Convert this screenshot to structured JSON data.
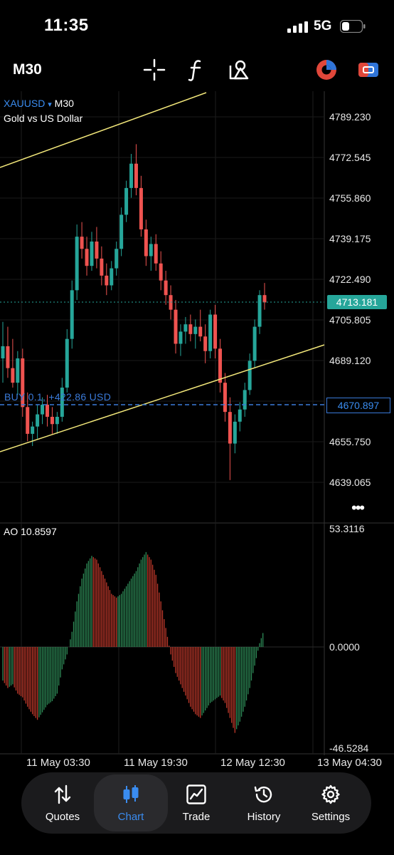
{
  "status": {
    "time": "11:35",
    "network": "5G"
  },
  "toolbar": {
    "timeframe": "M30",
    "icons": [
      "crosshair-icon",
      "function-icon",
      "objects-icon",
      "one-click-trading-icon",
      "account-icon"
    ]
  },
  "chart": {
    "symbol": "XAUUSD",
    "dropdown": "▾",
    "timeframe": "M30",
    "description": "Gold vs US Dollar",
    "current_price": "4713.181",
    "order_price": "4670.897",
    "order_label": "BUY 0.1, +422.86 USD",
    "price_labels": [
      "4789.230",
      "4772.545",
      "4755.860",
      "4739.175",
      "4722.490",
      "4705.805",
      "4689.120",
      "4655.750",
      "4639.065"
    ],
    "time_labels": [
      "11 May 03:30",
      "11 May 19:30",
      "12 May 12:30",
      "13 May 04:30"
    ],
    "more": "•••",
    "colors": {
      "bull": "#26a69a",
      "bear": "#ef5350",
      "trendline": "#f2e77a",
      "order": "#3a7ad9",
      "bid_line": "#26a69a"
    }
  },
  "indicator": {
    "label": "AO 10.8597",
    "max": "53.3116",
    "zero": "0.0000",
    "min": "-46.5284"
  },
  "chart_data": {
    "type": "candlestick",
    "symbol": "XAUUSD",
    "timeframe": "M30",
    "ylim": [
      4630,
      4800
    ],
    "candles": [
      [
        4690,
        4705,
        4680,
        4695
      ],
      [
        4695,
        4703,
        4682,
        4686
      ],
      [
        4686,
        4698,
        4678,
        4680
      ],
      [
        4680,
        4693,
        4675,
        4690
      ],
      [
        4690,
        4694,
        4666,
        4670
      ],
      [
        4670,
        4676,
        4656,
        4659
      ],
      [
        4659,
        4664,
        4654,
        4662
      ],
      [
        4662,
        4671,
        4657,
        4667
      ],
      [
        4667,
        4674,
        4663,
        4671
      ],
      [
        4671,
        4675,
        4662,
        4666
      ],
      [
        4666,
        4670,
        4659,
        4663
      ],
      [
        4663,
        4668,
        4659,
        4666
      ],
      [
        4666,
        4682,
        4664,
        4678
      ],
      [
        4678,
        4702,
        4676,
        4698
      ],
      [
        4698,
        4722,
        4694,
        4718
      ],
      [
        4718,
        4745,
        4714,
        4740
      ],
      [
        4740,
        4746,
        4731,
        4735
      ],
      [
        4735,
        4740,
        4724,
        4728
      ],
      [
        4728,
        4742,
        4726,
        4738
      ],
      [
        4738,
        4744,
        4727,
        4731
      ],
      [
        4731,
        4736,
        4720,
        4724
      ],
      [
        4724,
        4729,
        4716,
        4720
      ],
      [
        4720,
        4730,
        4718,
        4727
      ],
      [
        4727,
        4738,
        4724,
        4735
      ],
      [
        4735,
        4752,
        4732,
        4749
      ],
      [
        4749,
        4763,
        4746,
        4760
      ],
      [
        4760,
        4774,
        4756,
        4770
      ],
      [
        4770,
        4778,
        4757,
        4760
      ],
      [
        4760,
        4765,
        4740,
        4743
      ],
      [
        4743,
        4747,
        4728,
        4732
      ],
      [
        4732,
        4740,
        4726,
        4737
      ],
      [
        4737,
        4741,
        4726,
        4729
      ],
      [
        4729,
        4734,
        4718,
        4722
      ],
      [
        4722,
        4726,
        4712,
        4716
      ],
      [
        4716,
        4720,
        4706,
        4710
      ],
      [
        4710,
        4714,
        4692,
        4696
      ],
      [
        4696,
        4704,
        4691,
        4701
      ],
      [
        4701,
        4707,
        4696,
        4704
      ],
      [
        4704,
        4708,
        4697,
        4700
      ],
      [
        4700,
        4706,
        4694,
        4703
      ],
      [
        4703,
        4710,
        4697,
        4699
      ],
      [
        4699,
        4704,
        4688,
        4693
      ],
      [
        4693,
        4710,
        4690,
        4708
      ],
      [
        4708,
        4712,
        4690,
        4694
      ],
      [
        4694,
        4698,
        4676,
        4680
      ],
      [
        4680,
        4684,
        4664,
        4668
      ],
      [
        4668,
        4674,
        4640,
        4655
      ],
      [
        4655,
        4667,
        4651,
        4664
      ],
      [
        4664,
        4672,
        4660,
        4669
      ],
      [
        4669,
        4680,
        4666,
        4677
      ],
      [
        4677,
        4692,
        4675,
        4689
      ],
      [
        4689,
        4706,
        4686,
        4703
      ],
      [
        4703,
        4718,
        4700,
        4716
      ],
      [
        4716,
        4721,
        4710,
        4713
      ]
    ],
    "ao": [
      -18,
      -22,
      -20,
      -25,
      -27,
      -32,
      -36,
      -39,
      -35,
      -31,
      -29,
      -25,
      -12,
      -4,
      8,
      24,
      36,
      44,
      48,
      46,
      40,
      34,
      28,
      26,
      28,
      32,
      36,
      40,
      46,
      50,
      46,
      38,
      24,
      10,
      -4,
      -14,
      -20,
      -26,
      -32,
      -36,
      -38,
      -34,
      -30,
      -28,
      -26,
      -30,
      -38,
      -46,
      -40,
      -32,
      -22,
      -10,
      2,
      10
    ]
  }
}
